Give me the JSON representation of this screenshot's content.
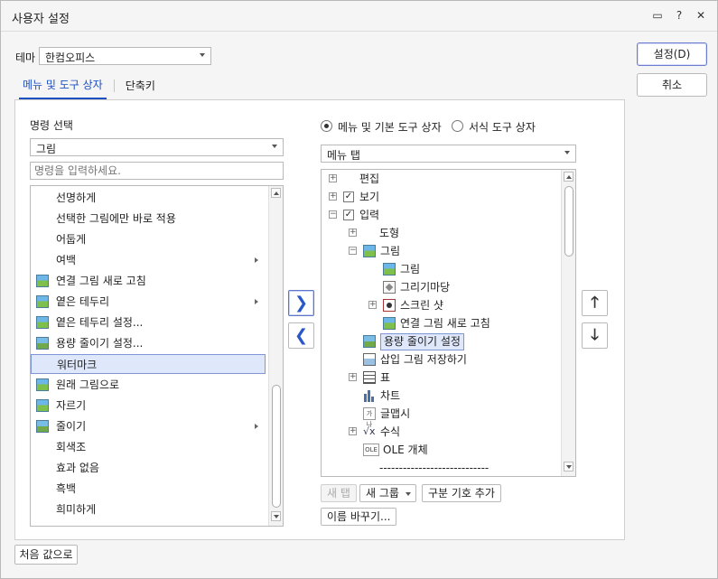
{
  "window": {
    "title": "사용자 설정"
  },
  "titlebar_icons": [
    "help-comment-icon",
    "question-icon",
    "close-icon"
  ],
  "titlebar_glyphs": {
    "comment": "▭",
    "question": "?",
    "close": "✕"
  },
  "theme": {
    "label": "테마",
    "value": "한컴오피스"
  },
  "tabs": [
    {
      "label": "메뉴 및 도구 상자",
      "active": true
    },
    {
      "label": "단축키",
      "active": false
    }
  ],
  "buttons": {
    "settings": "설정(D)",
    "cancel": "취소",
    "reset": "처음 값으로"
  },
  "command": {
    "title": "명령 선택",
    "category": "그림",
    "search_placeholder": "명령을 입력하세요.",
    "items": [
      {
        "label": "선명하게",
        "icon": "",
        "submenu": false
      },
      {
        "label": "선택한 그림에만 바로 적용",
        "icon": "",
        "submenu": false
      },
      {
        "label": "어둡게",
        "icon": "",
        "submenu": false
      },
      {
        "label": "여백",
        "icon": "",
        "submenu": true
      },
      {
        "label": "연결 그림 새로 고침",
        "icon": "picture-refresh-icon",
        "submenu": false
      },
      {
        "label": "옅은 테두리",
        "icon": "picture-border-icon",
        "submenu": true
      },
      {
        "label": "옅은 테두리 설정...",
        "icon": "picture-border-settings-icon",
        "submenu": false
      },
      {
        "label": "용량 줄이기 설정...",
        "icon": "picture-compress-icon",
        "submenu": false
      },
      {
        "label": "워터마크",
        "icon": "",
        "submenu": false,
        "selected": true
      },
      {
        "label": "원래 그림으로",
        "icon": "picture-restore-icon",
        "submenu": false
      },
      {
        "label": "자르기",
        "icon": "picture-crop-icon",
        "submenu": false
      },
      {
        "label": "줄이기",
        "icon": "picture-reduce-icon",
        "submenu": true
      },
      {
        "label": "회색조",
        "icon": "",
        "submenu": false
      },
      {
        "label": "효과 없음",
        "icon": "",
        "submenu": false
      },
      {
        "label": "흑백",
        "icon": "",
        "submenu": false
      },
      {
        "label": "희미하게",
        "icon": "",
        "submenu": false
      }
    ]
  },
  "mode": {
    "option1": "메뉴 및 기본 도구 상자",
    "option2": "서식 도구 상자",
    "selected": "option1"
  },
  "menu_select": "메뉴 탭",
  "tree": [
    {
      "label": "편집",
      "level": 0,
      "toggle": "+",
      "check": false,
      "icon": ""
    },
    {
      "label": "보기",
      "level": 0,
      "toggle": "+",
      "check": true,
      "icon": ""
    },
    {
      "label": "입력",
      "level": 0,
      "toggle": "-",
      "check": true,
      "icon": ""
    },
    {
      "label": "도형",
      "level": 1,
      "toggle": "+",
      "check": false,
      "icon": ""
    },
    {
      "label": "그림",
      "level": 1,
      "toggle": "-",
      "check": false,
      "icon": "picture-icon"
    },
    {
      "label": "그림",
      "level": 2,
      "toggle": "",
      "check": false,
      "icon": "picture-icon"
    },
    {
      "label": "그리기마당",
      "level": 2,
      "toggle": "",
      "check": false,
      "icon": "drawing-gallery-icon"
    },
    {
      "label": "스크린 샷",
      "level": 2,
      "toggle": "+",
      "check": false,
      "icon": "screenshot-icon"
    },
    {
      "label": "연결 그림 새로 고침",
      "level": 2,
      "toggle": "",
      "check": false,
      "icon": "picture-refresh-icon"
    },
    {
      "label": "용량 줄이기 설정",
      "level": 1,
      "toggle": "",
      "check": false,
      "icon": "picture-compress-icon",
      "selected": true
    },
    {
      "label": "삽입 그림 저장하기",
      "level": 1,
      "toggle": "",
      "check": false,
      "icon": "save-picture-icon"
    },
    {
      "label": "표",
      "level": 1,
      "toggle": "+",
      "check": false,
      "icon": "table-icon"
    },
    {
      "label": "차트",
      "level": 1,
      "toggle": "",
      "check": false,
      "icon": "chart-icon"
    },
    {
      "label": "글맵시",
      "level": 1,
      "toggle": "",
      "check": false,
      "icon": "text-art-icon"
    },
    {
      "label": "수식",
      "level": 1,
      "toggle": "+",
      "check": false,
      "icon": "formula-icon"
    },
    {
      "label": "OLE 개체",
      "level": 1,
      "toggle": "",
      "check": false,
      "icon": "ole-icon"
    },
    {
      "label": "----------------------------",
      "level": 1,
      "toggle": "",
      "check": false,
      "icon": ""
    }
  ],
  "tree_buttons": {
    "new_tab": "새 탭",
    "new_group": "새 그룹",
    "add_separator": "구분 기호 추가",
    "rename": "이름 바꾸기..."
  },
  "icon_text": {
    "ole": "OLE",
    "text_art": "가나",
    "formula": "√x"
  },
  "move": {
    "right": "❯",
    "left": "❮",
    "up": "🡑",
    "down": "🡓"
  },
  "check_glyph": "✓",
  "colors": {
    "accent": "#1e4fc3",
    "selection_bg": "#dfe7fb",
    "selection_border": "#7f95d8"
  }
}
